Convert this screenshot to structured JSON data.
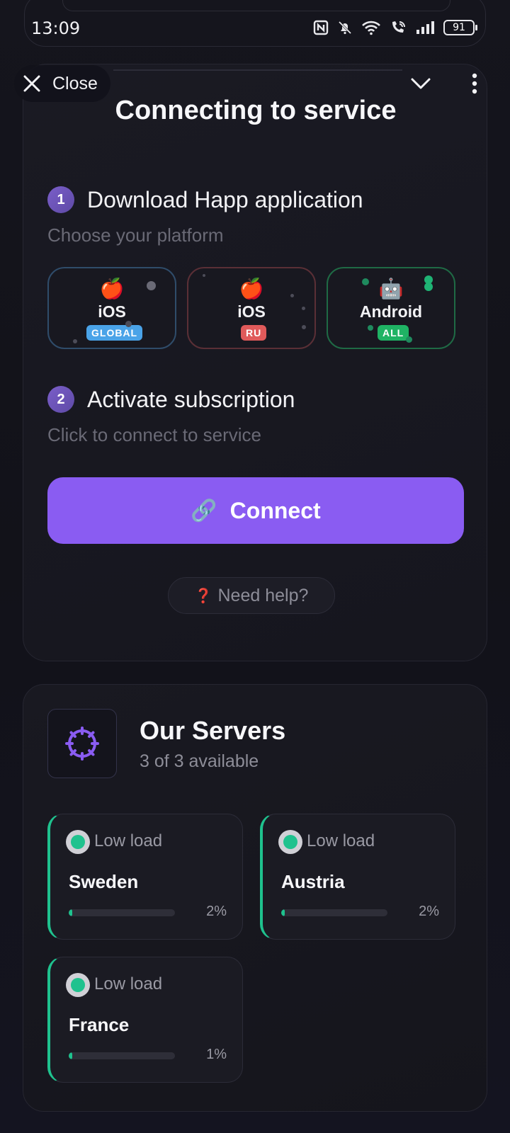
{
  "status_bar": {
    "time": "13:09",
    "battery": "91",
    "icons": [
      "nfc-icon",
      "bell-muted-icon",
      "wifi-icon",
      "wifi-call-icon",
      "signal-icon",
      "battery-icon"
    ]
  },
  "toolbar": {
    "close_label": "Close",
    "collapse_icon": "chevron-down-icon",
    "more_icon": "more-vertical-icon"
  },
  "connect_card": {
    "title": "Connecting to service",
    "step1": {
      "number": "1",
      "title": "Download Happ application",
      "subtitle": "Choose your platform"
    },
    "platforms": [
      {
        "icon": "apple-icon",
        "glyph": "🍎",
        "label": "iOS",
        "badge": "GLOBAL",
        "badge_color": "#4aa3e8",
        "border_color": "#2f4c6a"
      },
      {
        "icon": "apple-icon",
        "glyph": "🍎",
        "label": "iOS",
        "badge": "RU",
        "badge_color": "#e05a5a",
        "border_color": "#5a2f36"
      },
      {
        "icon": "robot-icon",
        "glyph": "🤖",
        "label": "Android",
        "badge": "ALL",
        "badge_color": "#1fb364",
        "border_color": "#1f6a45"
      }
    ],
    "step2": {
      "number": "2",
      "title": "Activate subscription",
      "subtitle": "Click to connect to service"
    },
    "connect_button": {
      "icon": "link-icon",
      "glyph": "🔗",
      "label": "Connect",
      "color": "#8a5cf2"
    },
    "help_button": {
      "icon": "question-icon",
      "glyph": "❓",
      "label": "Need help?"
    }
  },
  "servers_card": {
    "icon": "globe-icon",
    "title": "Our Servers",
    "subtitle": "3 of 3 available",
    "servers": [
      {
        "load_text": "Low load",
        "country": "Sweden",
        "load_percent": 2,
        "load_label": "2%"
      },
      {
        "load_text": "Low load",
        "country": "Austria",
        "load_percent": 2,
        "load_label": "2%"
      },
      {
        "load_text": "Low load",
        "country": "France",
        "load_percent": 1,
        "load_label": "1%"
      }
    ]
  },
  "colors": {
    "accent": "#8a5cf2",
    "status_green": "#1fc28e",
    "background": "#121219"
  }
}
